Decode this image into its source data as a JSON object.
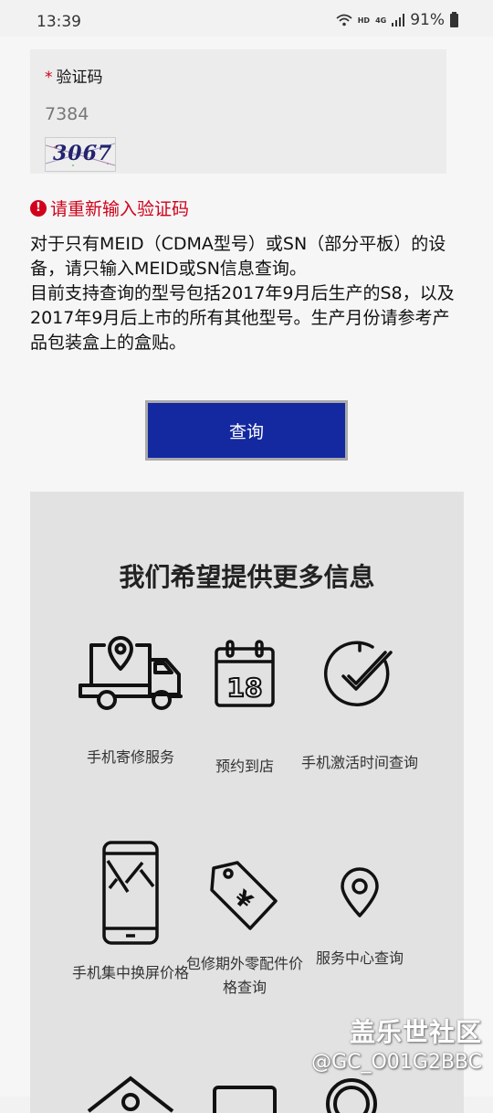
{
  "status": {
    "time": "13:39",
    "network_hd": "HD",
    "network_4g": "4G",
    "battery": "91%"
  },
  "captcha": {
    "required_mark": "*",
    "label": "验证码",
    "input_value": "7384",
    "image_text": "3067"
  },
  "error": {
    "message": "请重新输入验证码"
  },
  "notice": {
    "line1": "对于只有MEID（CDMA型号）或SN（部分平板）的设备，请只输入MEID或SN信息查询。",
    "line2": "目前支持查询的型号包括2017年9月后生产的S8，以及2017年9月后上市的所有其他型号。生产月份请参考产品包装盒上的盒贴。"
  },
  "query_button": {
    "label": "查询"
  },
  "info": {
    "title": "我们希望提供更多信息",
    "services": [
      {
        "label": "手机寄修服务",
        "icon": "truck-location-icon"
      },
      {
        "label": "预约到店",
        "icon": "calendar-18-icon"
      },
      {
        "label": "手机激活时间查询",
        "icon": "clock-check-icon"
      },
      {
        "label": "手机集中换屏价格",
        "icon": "cracked-phone-icon"
      },
      {
        "label": "包修期外零配件价格查询",
        "icon": "price-tag-yen-icon"
      },
      {
        "label": "服务中心查询",
        "icon": "location-pin-icon"
      }
    ],
    "calendar_day": "18",
    "yen_symbol": "¥"
  },
  "watermark": {
    "line1": "盖乐世社区",
    "line2": "@GC_O01G2BBC"
  }
}
